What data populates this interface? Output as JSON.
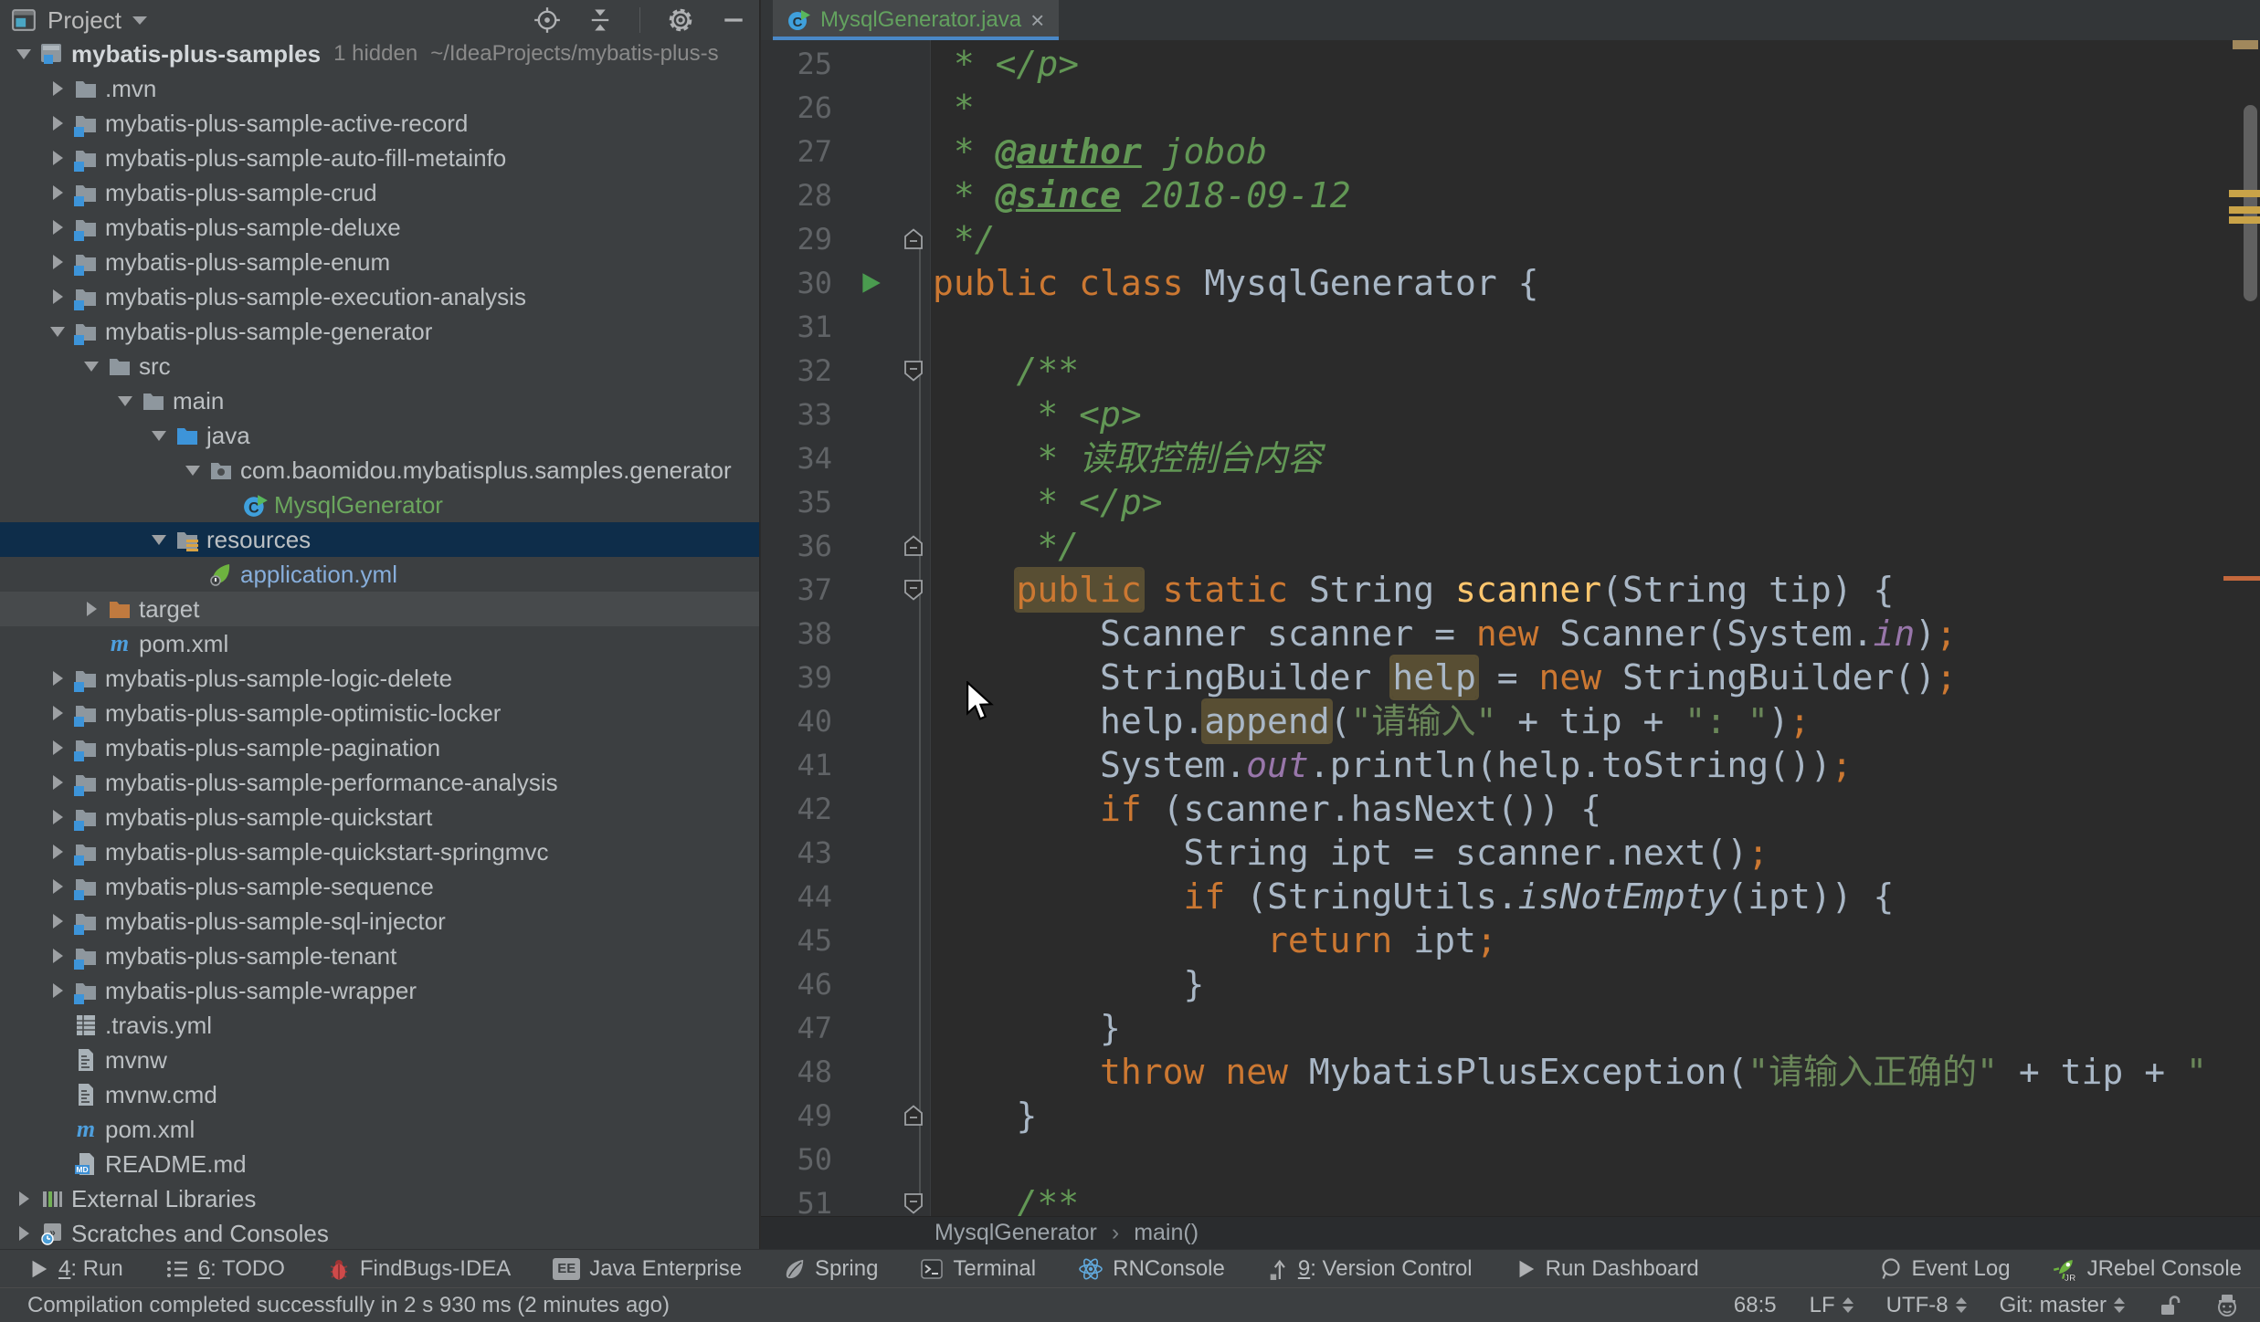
{
  "theme": {
    "panel_bg": "#3C3F41",
    "editor_bg": "#2B2B2B",
    "gutter_bg": "#313335",
    "selection_bg": "#0E2D4A",
    "hover_bg": "#474A4C",
    "tab_underline": "#4A88C7",
    "keyword": "#CC7832",
    "string": "#6A8759",
    "comment": "#629755",
    "method": "#FFC66D",
    "plain_text": "#A9B7C6",
    "field": "#9876AA",
    "line_number": "#606366",
    "highlight_bg": "#584E33",
    "run_green": "#499C54",
    "green": "#6BA65D",
    "blue": "#87AEDB"
  },
  "project_panel": {
    "header": {
      "title": "Project"
    },
    "tree": [
      {
        "lv": 0,
        "ar": "down",
        "ic": "project",
        "t": "mybatis-plus-samples",
        "bold": 1,
        "extra": "1 hidden",
        "path": "~/IdeaProjects/mybatis-plus-s"
      },
      {
        "lv": 1,
        "ar": "right",
        "ic": "folder",
        "t": ".mvn"
      },
      {
        "lv": 1,
        "ar": "right",
        "ic": "module",
        "t": "mybatis-plus-sample-active-record"
      },
      {
        "lv": 1,
        "ar": "right",
        "ic": "module",
        "t": "mybatis-plus-sample-auto-fill-metainfo"
      },
      {
        "lv": 1,
        "ar": "right",
        "ic": "module",
        "t": "mybatis-plus-sample-crud"
      },
      {
        "lv": 1,
        "ar": "right",
        "ic": "module",
        "t": "mybatis-plus-sample-deluxe"
      },
      {
        "lv": 1,
        "ar": "right",
        "ic": "module",
        "t": "mybatis-plus-sample-enum"
      },
      {
        "lv": 1,
        "ar": "right",
        "ic": "module",
        "t": "mybatis-plus-sample-execution-analysis"
      },
      {
        "lv": 1,
        "ar": "down",
        "ic": "module",
        "t": "mybatis-plus-sample-generator"
      },
      {
        "lv": 2,
        "ar": "down",
        "ic": "folder",
        "t": "src"
      },
      {
        "lv": 3,
        "ar": "down",
        "ic": "folder",
        "t": "main"
      },
      {
        "lv": 4,
        "ar": "down",
        "ic": "srcfolder",
        "t": "java"
      },
      {
        "lv": 5,
        "ar": "down",
        "ic": "package",
        "t": "com.baomidou.mybatisplus.samples.generator"
      },
      {
        "lv": 6,
        "ic": "classrun",
        "t": "MysqlGenerator",
        "color": "green"
      },
      {
        "lv": 4,
        "ar": "down",
        "ic": "resfolder",
        "t": "resources",
        "sel": 1
      },
      {
        "lv": 5,
        "ic": "spring",
        "t": "application.yml",
        "color": "blue"
      },
      {
        "lv": 2,
        "ar": "right",
        "ic": "targetfolder",
        "t": "target",
        "hov": 1
      },
      {
        "lv": 2,
        "ic": "maven",
        "t": "pom.xml"
      },
      {
        "lv": 1,
        "ar": "right",
        "ic": "module",
        "t": "mybatis-plus-sample-logic-delete"
      },
      {
        "lv": 1,
        "ar": "right",
        "ic": "module",
        "t": "mybatis-plus-sample-optimistic-locker"
      },
      {
        "lv": 1,
        "ar": "right",
        "ic": "module",
        "t": "mybatis-plus-sample-pagination"
      },
      {
        "lv": 1,
        "ar": "right",
        "ic": "module",
        "t": "mybatis-plus-sample-performance-analysis"
      },
      {
        "lv": 1,
        "ar": "right",
        "ic": "module",
        "t": "mybatis-plus-sample-quickstart"
      },
      {
        "lv": 1,
        "ar": "right",
        "ic": "module",
        "t": "mybatis-plus-sample-quickstart-springmvc"
      },
      {
        "lv": 1,
        "ar": "right",
        "ic": "module",
        "t": "mybatis-plus-sample-sequence"
      },
      {
        "lv": 1,
        "ar": "right",
        "ic": "module",
        "t": "mybatis-plus-sample-sql-injector"
      },
      {
        "lv": 1,
        "ar": "right",
        "ic": "module",
        "t": "mybatis-plus-sample-tenant"
      },
      {
        "lv": 1,
        "ar": "right",
        "ic": "module",
        "t": "mybatis-plus-sample-wrapper"
      },
      {
        "lv": 1,
        "ic": "yaml",
        "t": ".travis.yml"
      },
      {
        "lv": 1,
        "ic": "script",
        "t": "mvnw"
      },
      {
        "lv": 1,
        "ic": "script",
        "t": "mvnw.cmd"
      },
      {
        "lv": 1,
        "ic": "maven",
        "t": "pom.xml"
      },
      {
        "lv": 1,
        "ic": "md",
        "t": "README.md"
      },
      {
        "lv": 0,
        "ar": "right",
        "ic": "extlib",
        "t": "External Libraries"
      },
      {
        "lv": 0,
        "ar": "right",
        "ic": "scratch",
        "t": "Scratches and Consoles"
      }
    ]
  },
  "editor": {
    "tab": {
      "label": "MysqlGenerator.java",
      "close": "×"
    },
    "breadcrumbs": [
      "MysqlGenerator",
      "main()"
    ],
    "breadcrumb_sep": "›",
    "code": [
      {
        "n": 25,
        "seg": [
          [
            "doc",
            " * </p>"
          ]
        ]
      },
      {
        "n": 26,
        "seg": [
          [
            "doc",
            " *"
          ]
        ]
      },
      {
        "n": 27,
        "seg": [
          [
            "doc",
            " * "
          ],
          [
            "doctag",
            "@author"
          ],
          [
            "doc",
            " jobob"
          ]
        ]
      },
      {
        "n": 28,
        "seg": [
          [
            "doc",
            " * "
          ],
          [
            "doctag",
            "@since"
          ],
          [
            "doc",
            " 2018-09-12"
          ]
        ]
      },
      {
        "n": 29,
        "marks": [
          "foldUp"
        ],
        "seg": [
          [
            "doc",
            " */"
          ]
        ]
      },
      {
        "n": 30,
        "marks": [
          "run"
        ],
        "seg": [
          [
            "kw",
            "public class"
          ],
          [
            "plain",
            " MysqlGenerator {"
          ]
        ]
      },
      {
        "n": 31,
        "seg": []
      },
      {
        "n": 32,
        "marks": [
          "foldDown"
        ],
        "seg": [
          [
            "doc",
            "    /**"
          ]
        ]
      },
      {
        "n": 33,
        "seg": [
          [
            "doc",
            "     * <p>"
          ]
        ]
      },
      {
        "n": 34,
        "seg": [
          [
            "doc",
            "     * 读取控制台内容"
          ]
        ]
      },
      {
        "n": 35,
        "seg": [
          [
            "doc",
            "     * </p>"
          ]
        ]
      },
      {
        "n": 36,
        "marks": [
          "foldUp"
        ],
        "seg": [
          [
            "doc",
            "     */"
          ]
        ]
      },
      {
        "n": 37,
        "marks": [
          "foldDown"
        ],
        "seg": [
          [
            "ws",
            "    "
          ],
          [
            "kw hl",
            "public"
          ],
          [
            "kw",
            " static"
          ],
          [
            "plain",
            " String "
          ],
          [
            "mname",
            "scanner"
          ],
          [
            "plain",
            "(String tip) {"
          ]
        ]
      },
      {
        "n": 38,
        "seg": [
          [
            "plain",
            "        Scanner scanner = "
          ],
          [
            "kw",
            "new"
          ],
          [
            "plain",
            " Scanner(System."
          ],
          [
            "field",
            "in"
          ],
          [
            "plain",
            ")"
          ],
          [
            "semi",
            ";"
          ]
        ]
      },
      {
        "n": 39,
        "seg": [
          [
            "plain",
            "        StringBuilder "
          ],
          [
            "plain hl",
            "help"
          ],
          [
            "plain",
            " = "
          ],
          [
            "kw",
            "new"
          ],
          [
            "plain",
            " StringBuilder()"
          ],
          [
            "semi",
            ";"
          ]
        ]
      },
      {
        "n": 40,
        "seg": [
          [
            "plain",
            "        help."
          ],
          [
            "plain hl",
            "append"
          ],
          [
            "plain",
            "("
          ],
          [
            "str",
            "\"请输入\""
          ],
          [
            "plain",
            " + tip + "
          ],
          [
            "str",
            "\": \""
          ],
          [
            "plain",
            ")"
          ],
          [
            "semi",
            ";"
          ]
        ]
      },
      {
        "n": 41,
        "seg": [
          [
            "plain",
            "        System."
          ],
          [
            "field",
            "out"
          ],
          [
            "plain",
            ".println(help.toString())"
          ],
          [
            "semi",
            ";"
          ]
        ]
      },
      {
        "n": 42,
        "seg": [
          [
            "ws",
            "        "
          ],
          [
            "kw",
            "if"
          ],
          [
            "plain",
            " (scanner.hasNext()) {"
          ]
        ]
      },
      {
        "n": 43,
        "seg": [
          [
            "plain",
            "            String ipt = scanner.next()"
          ],
          [
            "semi",
            ";"
          ]
        ]
      },
      {
        "n": 44,
        "seg": [
          [
            "ws",
            "            "
          ],
          [
            "kw",
            "if"
          ],
          [
            "plain",
            " (StringUtils."
          ],
          [
            "plain i",
            "isNotEmpty"
          ],
          [
            "plain",
            "(ipt)) {"
          ]
        ]
      },
      {
        "n": 45,
        "seg": [
          [
            "ws",
            "                "
          ],
          [
            "kw",
            "return"
          ],
          [
            "plain",
            " ipt"
          ],
          [
            "semi",
            ";"
          ]
        ]
      },
      {
        "n": 46,
        "seg": [
          [
            "plain",
            "            }"
          ]
        ]
      },
      {
        "n": 47,
        "seg": [
          [
            "plain",
            "        }"
          ]
        ]
      },
      {
        "n": 48,
        "seg": [
          [
            "ws",
            "        "
          ],
          [
            "kw",
            "throw"
          ],
          [
            "plain",
            " "
          ],
          [
            "kw",
            "new"
          ],
          [
            "plain",
            " MybatisPlusException("
          ],
          [
            "str",
            "\"请输入正确的\""
          ],
          [
            "plain",
            " + tip + "
          ],
          [
            "str",
            "\""
          ]
        ]
      },
      {
        "n": 49,
        "marks": [
          "foldUp"
        ],
        "seg": [
          [
            "plain",
            "    }"
          ]
        ]
      },
      {
        "n": 50,
        "seg": []
      },
      {
        "n": 51,
        "marks": [
          "foldDown"
        ],
        "seg": [
          [
            "doc",
            "    /**"
          ]
        ]
      }
    ]
  },
  "status_toolbar": {
    "left": [
      {
        "ic": "play",
        "num": "4",
        "t": ": Run"
      },
      {
        "ic": "todo",
        "num": "6",
        "t": ": TODO"
      },
      {
        "ic": "bug",
        "t": "FindBugs-IDEA"
      },
      {
        "ic": "ee",
        "t": "Java Enterprise"
      },
      {
        "ic": "springleaf",
        "t": "Spring"
      },
      {
        "ic": "terminal",
        "t": "Terminal"
      },
      {
        "ic": "atom",
        "t": "RNConsole"
      },
      {
        "ic": "vcs",
        "num": "9",
        "t": ": Version Control"
      },
      {
        "ic": "play",
        "t": "Run Dashboard"
      }
    ],
    "right": [
      {
        "ic": "event",
        "t": "Event Log"
      },
      {
        "ic": "jrebel",
        "t": "JRebel Console"
      }
    ]
  },
  "status_bar": {
    "message": "Compilation completed successfully in 2 s 930 ms (2 minutes ago)",
    "widgets": [
      {
        "t": "68:5",
        "name": "caret-position-widget"
      },
      {
        "t": "LF",
        "updown": true,
        "name": "line-separator-widget"
      },
      {
        "t": "UTF-8",
        "updown": true,
        "name": "encoding-widget"
      },
      {
        "t": "Git: master",
        "updown": true,
        "name": "git-branch-widget"
      },
      {
        "ic": "unlock",
        "name": "readonly-toggle"
      },
      {
        "ic": "hector",
        "name": "inspections-widget"
      }
    ]
  }
}
